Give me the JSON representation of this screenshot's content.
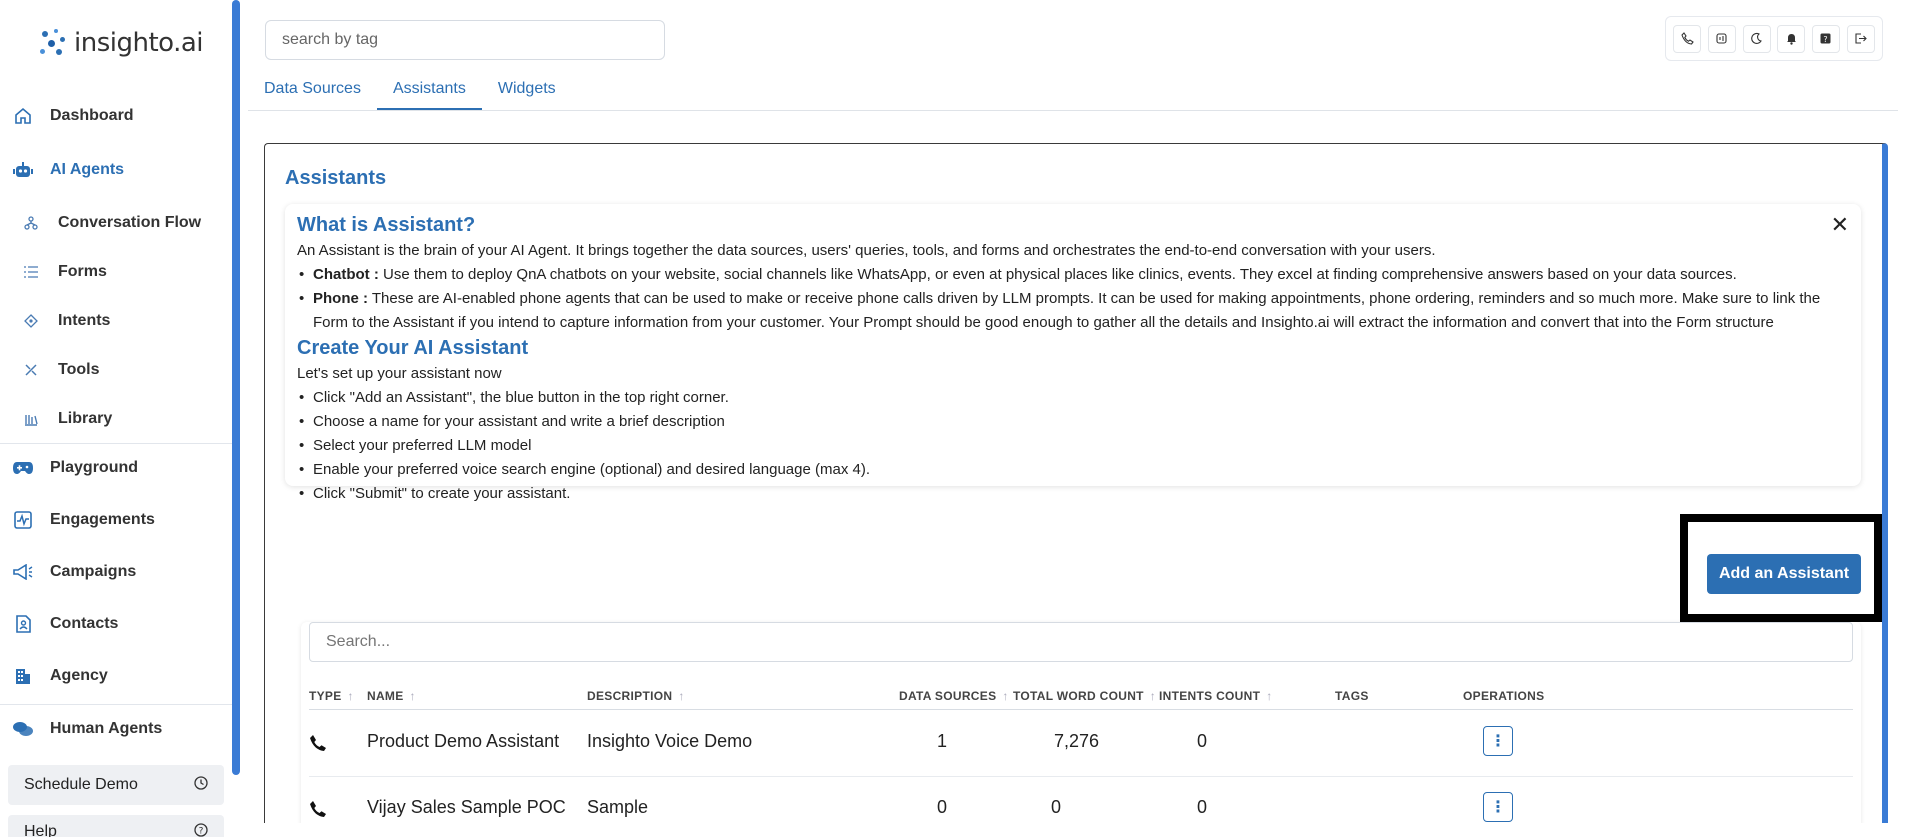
{
  "app": {
    "logo_text": "insighto.ai"
  },
  "sidebar": {
    "items": [
      {
        "label": "Dashboard",
        "icon": "home-icon"
      },
      {
        "label": "AI Agents",
        "icon": "robot-icon"
      },
      {
        "label": "Conversation Flow",
        "icon": "flow-icon"
      },
      {
        "label": "Forms",
        "icon": "list-icon"
      },
      {
        "label": "Intents",
        "icon": "target-icon"
      },
      {
        "label": "Tools",
        "icon": "tools-icon"
      },
      {
        "label": "Library",
        "icon": "library-icon"
      },
      {
        "label": "Playground",
        "icon": "gamepad-icon"
      },
      {
        "label": "Engagements",
        "icon": "chart-icon"
      },
      {
        "label": "Campaigns",
        "icon": "megaphone-icon"
      },
      {
        "label": "Contacts",
        "icon": "contact-icon"
      },
      {
        "label": "Agency",
        "icon": "building-icon"
      },
      {
        "label": "Human Agents",
        "icon": "chat-icon"
      }
    ],
    "schedule_demo": "Schedule Demo",
    "help": "Help"
  },
  "header": {
    "search_placeholder": "search by tag",
    "tabs": [
      "Data Sources",
      "Assistants",
      "Widgets"
    ],
    "active_tab": "Assistants",
    "icons": [
      "phone-icon",
      "voice-icon",
      "moon-icon",
      "bell-icon",
      "help-icon",
      "logout-icon"
    ]
  },
  "main": {
    "title": "Assistants",
    "info": {
      "what_title": "What is Assistant?",
      "what_intro": "An Assistant is the brain of your AI Agent. It brings together the data sources, users' queries, tools, and forms and orchestrates the end-to-end conversation with your users.",
      "chatbot_label": "Chatbot :",
      "chatbot_text": " Use them to deploy QnA chatbots on your website, social channels like WhatsApp, or even at physical places like clinics, events. They excel at finding comprehensive answers based on your data sources.",
      "phone_label": "Phone :",
      "phone_text": " These are AI-enabled phone agents that can be used to make or receive phone calls driven by LLM prompts. It can be used for making appointments, phone ordering, reminders and so much more. Make sure to link the Form to the Assistant if you intend to capture information from your customer. Your Prompt should be good enough to gather all the details and Insighto.ai will extract the information and convert that into the Form structure",
      "create_title": "Create Your AI Assistant",
      "create_intro": "Let's set up your assistant now",
      "steps": [
        "Click \"Add an Assistant\", the blue button in the top right corner.",
        "Choose a name for your assistant and write a brief description",
        "Select your preferred LLM model",
        "Enable your preferred voice search engine (optional) and desired language (max 4).",
        "Click \"Submit\" to create your assistant."
      ]
    },
    "add_button": "Add an Assistant",
    "table": {
      "search_placeholder": "Search...",
      "columns": [
        "TYPE",
        "NAME",
        "DESCRIPTION",
        "DATA SOURCES",
        "TOTAL WORD COUNT",
        "INTENTS COUNT",
        "TAGS",
        "OPERATIONS"
      ],
      "rows": [
        {
          "type_icon": "phone-icon",
          "name": "Product Demo Assistant",
          "description": "Insighto Voice Demo",
          "data_sources": "1",
          "word_count": "7,276",
          "intents": "0",
          "tags": ""
        },
        {
          "type_icon": "phone-icon",
          "name": "Vijay Sales Sample POC",
          "description": "Sample",
          "data_sources": "0",
          "word_count": "0",
          "intents": "0",
          "tags": ""
        }
      ]
    }
  },
  "colors": {
    "accent": "#2c6fb3",
    "scrollbar": "#3a7bd5"
  }
}
